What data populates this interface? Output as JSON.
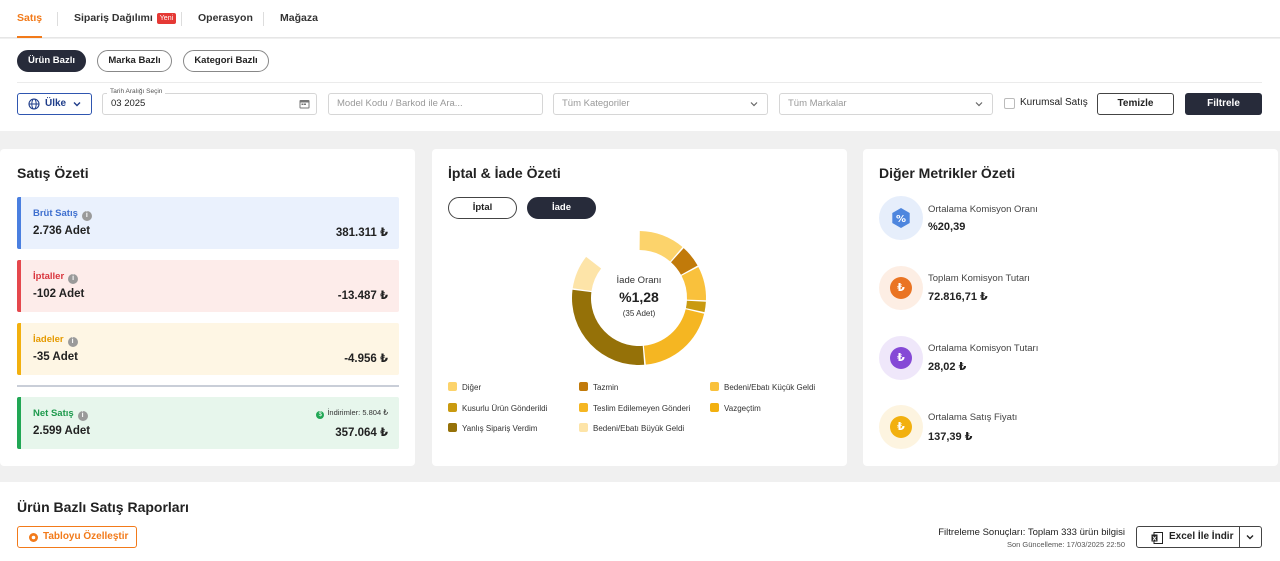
{
  "nav": {
    "tabs": [
      {
        "label": "Satış",
        "active": true
      },
      {
        "label": "Sipariş Dağılımı",
        "badge": "Yeni"
      },
      {
        "label": "Operasyon"
      },
      {
        "label": "Mağaza"
      }
    ]
  },
  "filters": {
    "views": [
      "Ürün Bazlı",
      "Marka Bazlı",
      "Kategori Bazlı"
    ],
    "country_label": "Ülke",
    "date_label": "Tarih Aralığı Seçin",
    "date_value": "03 2025",
    "search_placeholder": "Model Kodu / Barkod ile Ara...",
    "category_placeholder": "Tüm Kategoriler",
    "brand_placeholder": "Tüm Markalar",
    "corporate_label": "Kurumsal Satış",
    "clear_label": "Temizle",
    "filter_label": "Filtrele"
  },
  "sales_summary": {
    "title": "Satış Özeti",
    "gross": {
      "label": "Brüt Satış",
      "count": "2.736 Adet",
      "amount": "381.311 ₺"
    },
    "cancels": {
      "label": "İptaller",
      "count": "-102 Adet",
      "amount": "-13.487 ₺"
    },
    "returns": {
      "label": "İadeler",
      "count": "-35 Adet",
      "amount": "-4.956 ₺"
    },
    "net": {
      "label": "Net Satış",
      "count": "2.599 Adet",
      "amount": "357.064 ₺",
      "discount_label": "İndirimler:",
      "discount_value": "5.804 ₺"
    }
  },
  "cancel_return": {
    "title": "İptal & İade Özeti",
    "toggle": [
      "İptal",
      "İade"
    ],
    "center_title": "İade Oranı",
    "center_rate": "%1,28",
    "center_count": "(35 Adet)",
    "legend": [
      {
        "label": "Diğer",
        "color": "#fcd36b"
      },
      {
        "label": "Tazmin",
        "color": "#c17a0a"
      },
      {
        "label": "Bedeni/Ebatı Küçük Geldi",
        "color": "#f9c13c"
      },
      {
        "label": "Kusurlu Ürün Gönderildi",
        "color": "#c99a10"
      },
      {
        "label": "Teslim Edilemeyen Gönderi",
        "color": "#f5b622"
      },
      {
        "label": "Vazgeçtim",
        "color": "#f2b00f"
      },
      {
        "label": "Yanlış Sipariş Verdim",
        "color": "#957108"
      },
      {
        "label": "Bedeni/Ebatı Büyük Geldi",
        "color": "#fde4a8"
      }
    ]
  },
  "chart_data": {
    "type": "pie",
    "categories": [
      "Diğer",
      "Tazmin",
      "Bedeni/Ebatı Küçük Geldi",
      "Kusurlu Ürün Gönderildi",
      "Teslim Edilemeyen Gönderi",
      "Vazgeçtim",
      "Yanlış Sipariş Verdim",
      "Bedeni/Ebatı Büyük Geldi"
    ],
    "values": [
      4,
      2,
      3,
      1,
      7,
      5,
      10,
      3
    ],
    "colors": [
      "#fcd36b",
      "#c17a0a",
      "#f9c13c",
      "#c99a10",
      "#f5b622",
      "#f2b00f",
      "#957108",
      "#fde4a8"
    ]
  },
  "other_metrics": {
    "title": "Diğer Metrikler Özeti",
    "items": [
      {
        "label": "Ortalama Komisyon Oranı",
        "value": "%20,39",
        "icon": "percent-icon",
        "bg": "#e6eefb",
        "fg": "#4e86de",
        "glyph": "%"
      },
      {
        "label": "Toplam Komisyon Tutarı",
        "value": "72.816,71 ₺",
        "icon": "lira-icon",
        "bg": "#fdeee4",
        "fg": "#ea7423",
        "glyph": "₺"
      },
      {
        "label": "Ortalama Komisyon Tutarı",
        "value": "28,02 ₺",
        "icon": "lira-icon",
        "bg": "#efe7fa",
        "fg": "#8549d6",
        "glyph": "₺"
      },
      {
        "label": "Ortalama Satış Fiyatı",
        "value": "137,39 ₺",
        "icon": "lira-icon",
        "bg": "#fdf4e0",
        "fg": "#f2b00f",
        "glyph": "₺"
      }
    ]
  },
  "report": {
    "title": "Ürün Bazlı Satış Raporları",
    "customize_label": "Tabloyu Özelleştir",
    "results_text": "Filtreleme Sonuçları: Toplam 333 ürün bilgisi",
    "updated_text": "Son Güncelleme: 17/03/2025 22:50",
    "excel_label": "Excel İle İndir"
  }
}
